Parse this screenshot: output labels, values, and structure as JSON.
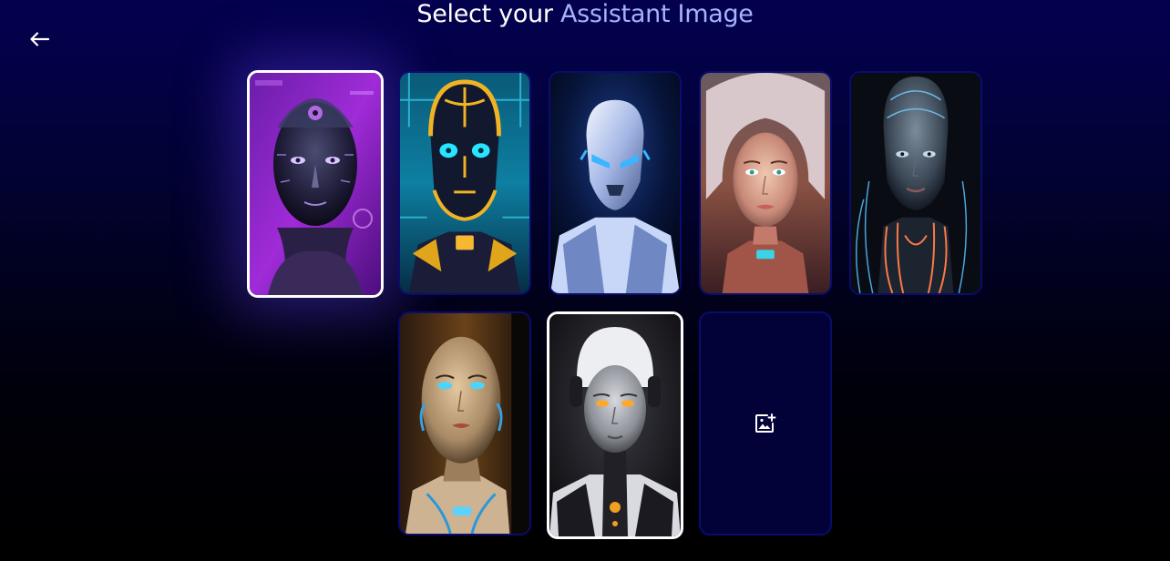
{
  "header": {
    "title_prefix": "Select your",
    "title_accent": "Assistant Image",
    "back_icon": "arrow-left-icon"
  },
  "images": [
    {
      "id": "purple-robot",
      "selected": true,
      "theme": "purple chrome android face"
    },
    {
      "id": "gold-robot",
      "selected": false,
      "theme": "gold and cyan circuit robot"
    },
    {
      "id": "white-armor-robot",
      "selected": false,
      "theme": "white blue armored robot"
    },
    {
      "id": "copper-woman",
      "selected": false,
      "theme": "woman with copper circuitry"
    },
    {
      "id": "wired-woman",
      "selected": false,
      "theme": "dark android woman with orange wires"
    },
    {
      "id": "tan-android",
      "selected": false,
      "theme": "tan android with blue eyes"
    },
    {
      "id": "silver-android",
      "selected": true,
      "theme": "silver android with headset"
    }
  ],
  "upload": {
    "icon": "add-image-icon"
  },
  "colors": {
    "accent_text": "#a7b2ff",
    "card_border": "#0a0c6e",
    "selected_border": "#ffffff",
    "background_top": "#03014f",
    "background_bottom": "#000000"
  }
}
